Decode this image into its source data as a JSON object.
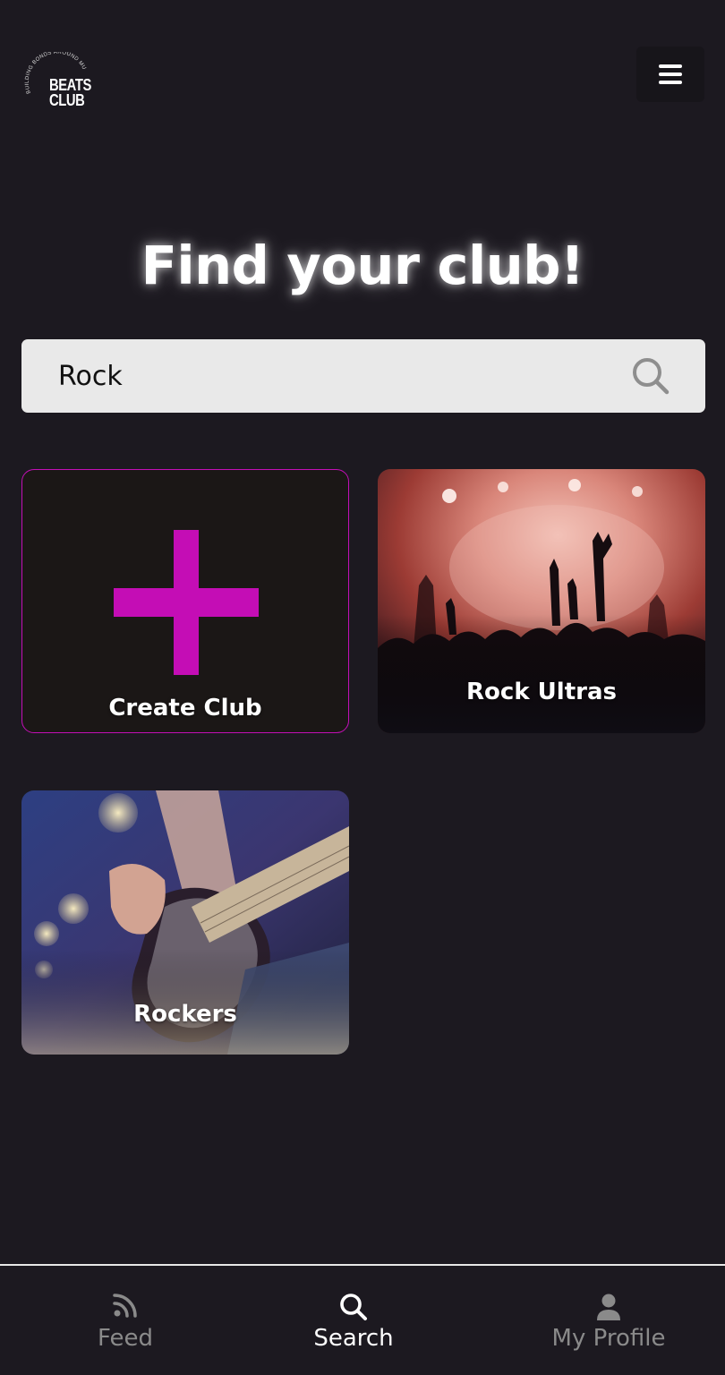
{
  "header": {
    "logo": {
      "name": "BEATS CLUB",
      "line1": "BEATS",
      "line2": "CLUB",
      "tagline": "BUILDING BONDS AROUND MUSIC"
    },
    "menu_icon": "hamburger-menu-icon"
  },
  "main": {
    "title": "Find your club!",
    "search": {
      "value": "Rock",
      "icon": "search-icon"
    },
    "clubs": [
      {
        "label": "Create Club",
        "icon": "plus-icon",
        "type": "create"
      },
      {
        "label": "Rock Ultras",
        "type": "club",
        "image": "concert-crowd-photo"
      },
      {
        "label": "Rockers",
        "type": "club",
        "image": "electric-guitar-photo"
      }
    ]
  },
  "bottom_nav": {
    "items": [
      {
        "label": "Feed",
        "icon": "rss-feed-icon",
        "active": false
      },
      {
        "label": "Search",
        "icon": "search-icon",
        "active": true
      },
      {
        "label": "My Profile",
        "icon": "user-icon",
        "active": false
      }
    ]
  },
  "colors": {
    "background": "#1c1920",
    "accent": "#c40db5",
    "search_bg": "#e9e9e9",
    "nav_inactive": "#8a8a8a",
    "nav_active": "#ffffff"
  }
}
